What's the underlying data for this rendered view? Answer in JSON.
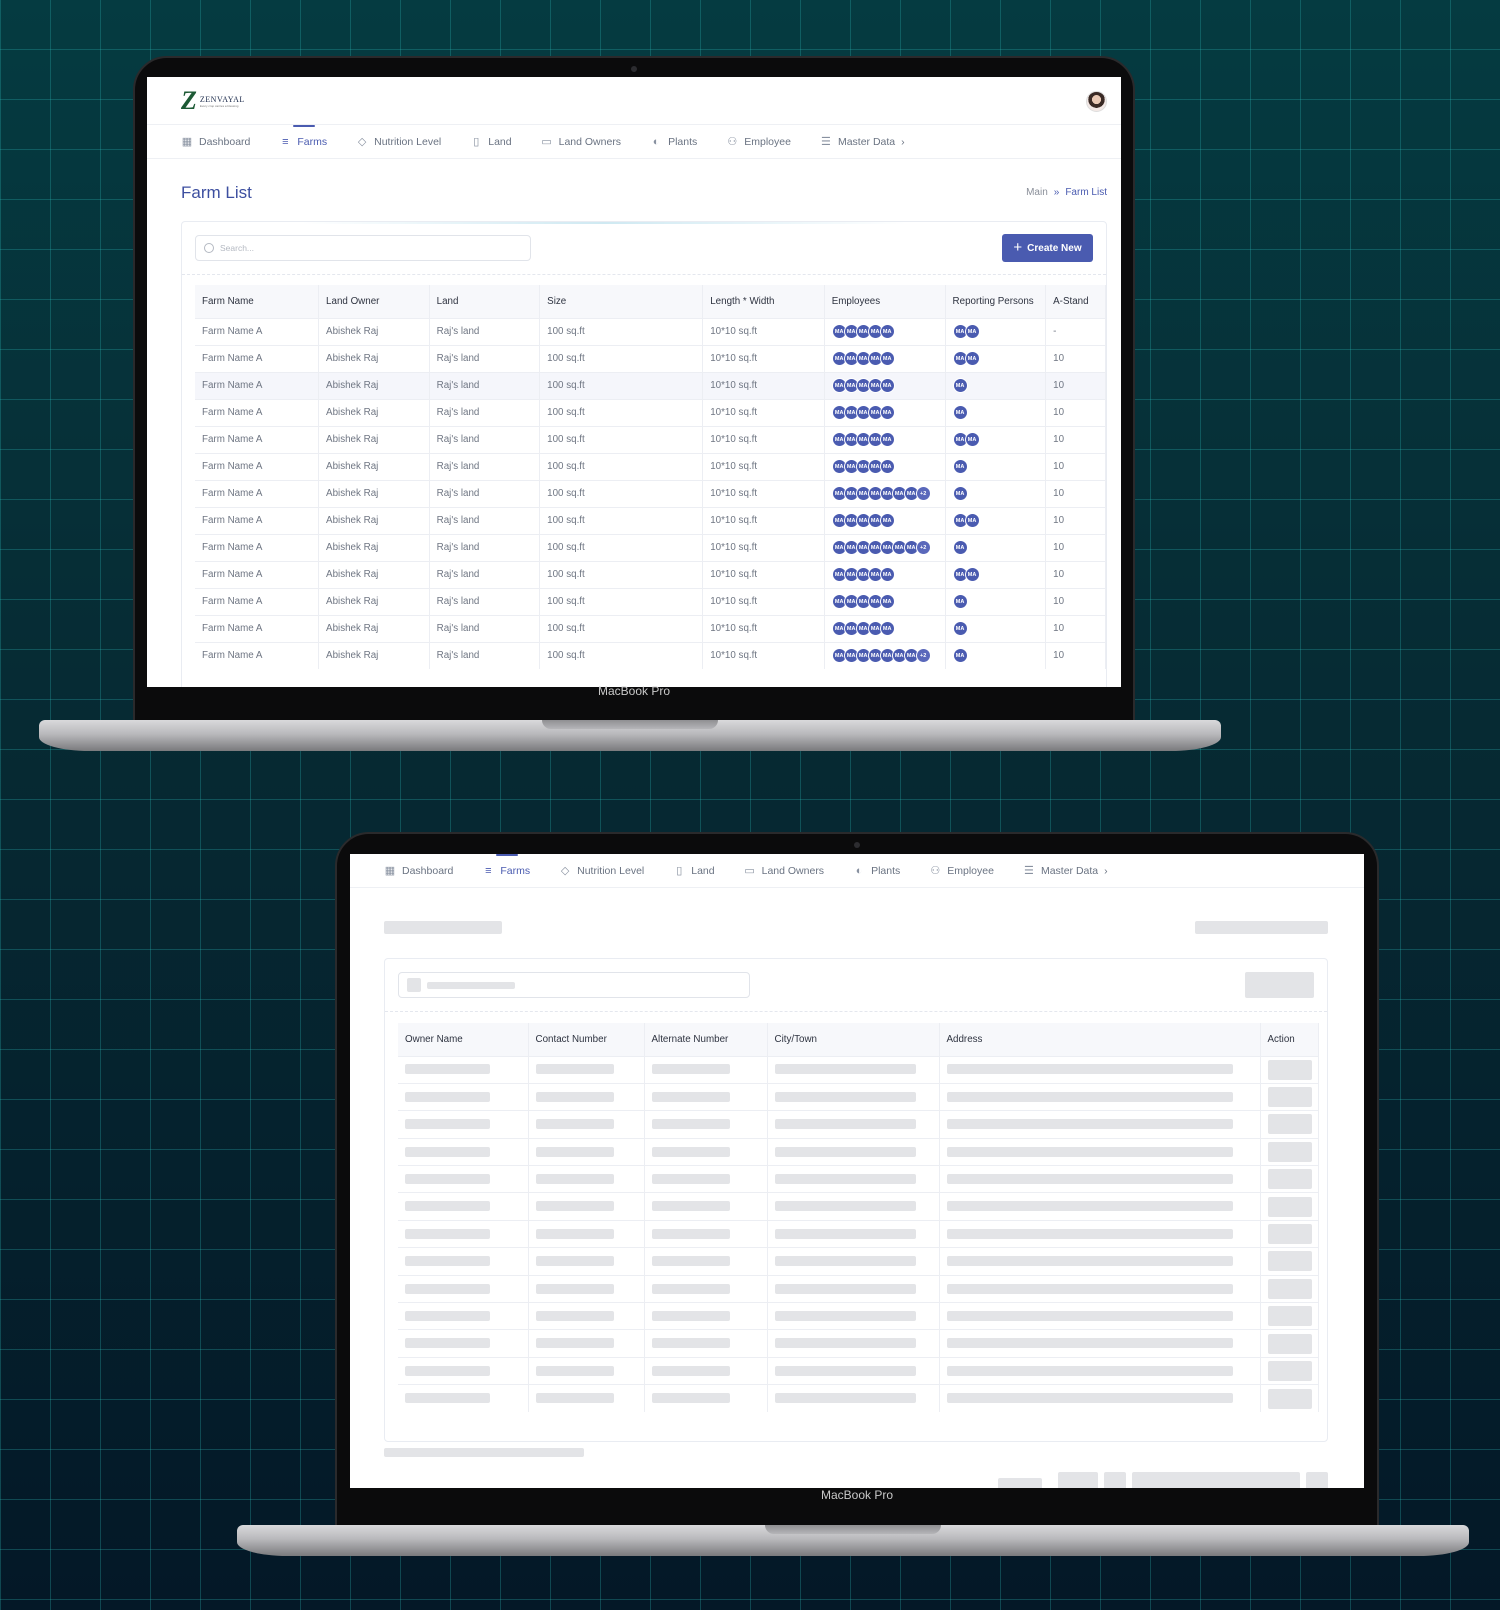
{
  "nav": {
    "items": [
      {
        "label": "Dashboard",
        "icon": "grid-icon"
      },
      {
        "label": "Farms",
        "icon": "list-icon",
        "active": true
      },
      {
        "label": "Nutrition Level",
        "icon": "tag-icon"
      },
      {
        "label": "Land",
        "icon": "book-icon"
      },
      {
        "label": "Land Owners",
        "icon": "id-card-icon"
      },
      {
        "label": "Plants",
        "icon": "leaf-icon"
      },
      {
        "label": "Employee",
        "icon": "users-icon"
      },
      {
        "label": "Master Data",
        "icon": "database-icon"
      }
    ],
    "chevron": "›"
  },
  "brand": {
    "name": "ZENVAYAL",
    "mark": "Z",
    "tagline": "Every crop carries a blessing",
    "accent": "#4a5bb0",
    "mark_color": "#1d5a35"
  },
  "laptop": {
    "model": "MacBook Pro"
  },
  "page": {
    "title": "Farm List",
    "breadcrumb": {
      "root": "Main",
      "sep": "»",
      "current": "Farm List"
    },
    "search_placeholder": "Search...",
    "create_button": "Create New"
  },
  "farm_table": {
    "columns": [
      "Farm Name",
      "Land Owner",
      "Land",
      "Size",
      "Length * Width",
      "Employees",
      "Reporting Persons",
      "A-Stand"
    ],
    "chip_label": "MA",
    "rows": [
      {
        "farm": "Farm Name A",
        "owner": "Abishek Raj",
        "land": "Raj's land",
        "size": "100 sq.ft",
        "dims": "10*10 sq.ft",
        "employees": 5,
        "more": "",
        "reporting": 2,
        "astand": "-"
      },
      {
        "farm": "Farm Name A",
        "owner": "Abishek Raj",
        "land": "Raj's land",
        "size": "100 sq.ft",
        "dims": "10*10 sq.ft",
        "employees": 5,
        "more": "",
        "reporting": 2,
        "astand": "10"
      },
      {
        "farm": "Farm Name A",
        "owner": "Abishek Raj",
        "land": "Raj's land",
        "size": "100 sq.ft",
        "dims": "10*10 sq.ft",
        "employees": 5,
        "more": "",
        "reporting": 1,
        "astand": "10"
      },
      {
        "farm": "Farm Name A",
        "owner": "Abishek Raj",
        "land": "Raj's land",
        "size": "100 sq.ft",
        "dims": "10*10 sq.ft",
        "employees": 5,
        "more": "",
        "reporting": 1,
        "astand": "10"
      },
      {
        "farm": "Farm Name A",
        "owner": "Abishek Raj",
        "land": "Raj's land",
        "size": "100 sq.ft",
        "dims": "10*10 sq.ft",
        "employees": 5,
        "more": "",
        "reporting": 2,
        "astand": "10"
      },
      {
        "farm": "Farm Name A",
        "owner": "Abishek Raj",
        "land": "Raj's land",
        "size": "100 sq.ft",
        "dims": "10*10 sq.ft",
        "employees": 5,
        "more": "",
        "reporting": 1,
        "astand": "10"
      },
      {
        "farm": "Farm Name A",
        "owner": "Abishek Raj",
        "land": "Raj's land",
        "size": "100 sq.ft",
        "dims": "10*10 sq.ft",
        "employees": 7,
        "more": "+2",
        "reporting": 1,
        "astand": "10"
      },
      {
        "farm": "Farm Name A",
        "owner": "Abishek Raj",
        "land": "Raj's land",
        "size": "100 sq.ft",
        "dims": "10*10 sq.ft",
        "employees": 5,
        "more": "",
        "reporting": 2,
        "astand": "10"
      },
      {
        "farm": "Farm Name A",
        "owner": "Abishek Raj",
        "land": "Raj's land",
        "size": "100 sq.ft",
        "dims": "10*10 sq.ft",
        "employees": 7,
        "more": "+2",
        "reporting": 1,
        "astand": "10"
      },
      {
        "farm": "Farm Name A",
        "owner": "Abishek Raj",
        "land": "Raj's land",
        "size": "100 sq.ft",
        "dims": "10*10 sq.ft",
        "employees": 5,
        "more": "",
        "reporting": 2,
        "astand": "10"
      },
      {
        "farm": "Farm Name A",
        "owner": "Abishek Raj",
        "land": "Raj's land",
        "size": "100 sq.ft",
        "dims": "10*10 sq.ft",
        "employees": 5,
        "more": "",
        "reporting": 1,
        "astand": "10"
      },
      {
        "farm": "Farm Name A",
        "owner": "Abishek Raj",
        "land": "Raj's land",
        "size": "100 sq.ft",
        "dims": "10*10 sq.ft",
        "employees": 5,
        "more": "",
        "reporting": 1,
        "astand": "10"
      },
      {
        "farm": "Farm Name A",
        "owner": "Abishek Raj",
        "land": "Raj's land",
        "size": "100 sq.ft",
        "dims": "10*10 sq.ft",
        "employees": 7,
        "more": "+2",
        "reporting": 1,
        "astand": "10"
      }
    ]
  },
  "owner_table": {
    "columns": [
      "Owner Name",
      "Contact Number",
      "Alternate Number",
      "City/Town",
      "Address",
      "Action"
    ],
    "skeleton_rows": 13
  }
}
